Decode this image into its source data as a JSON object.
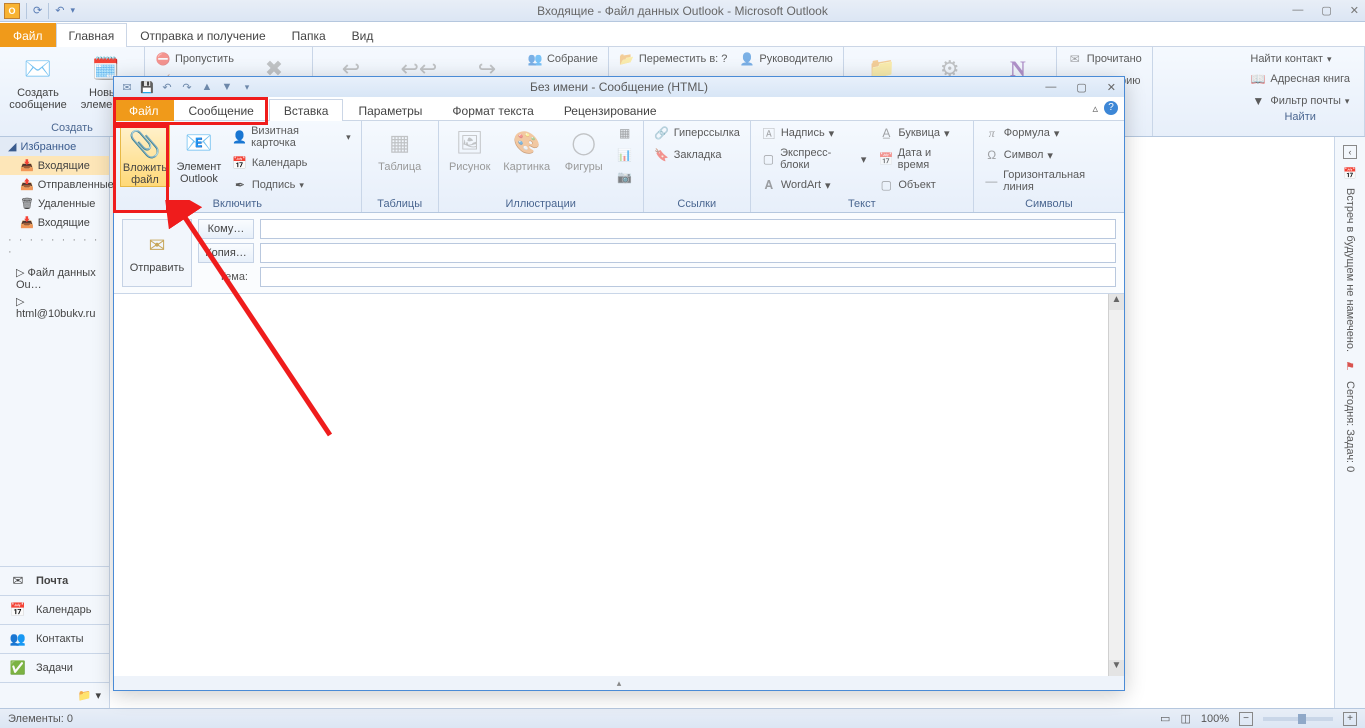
{
  "main_window": {
    "title": "Входящие - Файл данных Outlook  -  Microsoft Outlook",
    "tabs": {
      "file": "Файл",
      "home": "Главная",
      "sendrecv": "Отправка и получение",
      "folder": "Папка",
      "view": "Вид"
    },
    "ribbon": {
      "create": {
        "new_msg": "Создать\nсообщение",
        "new_items": "Новые\nэлементы",
        "title": "Создать"
      },
      "skip": "Пропустить",
      "meeting": "Собрание",
      "move_to": "Переместить в: ?",
      "manager": "Руководителю",
      "read": "Прочитано",
      "category": "Категорию",
      "search": {
        "find_contact": "Найти контакт",
        "addrbook": "Адресная книга",
        "mailfilter": "Фильтр почты",
        "title": "Найти"
      }
    },
    "nav": {
      "fav": "Избранное",
      "inbox": "Входящие",
      "sent": "Отправленные",
      "deleted": "Удаленные",
      "inbox2": "Входящие",
      "tree1": "Файл данных Ou…",
      "tree2": "html@10bukv.ru",
      "mail": "Почта",
      "cal": "Календарь",
      "contacts": "Контакты",
      "tasks": "Задачи"
    },
    "rightbar": {
      "line1": "Встреч в будущем не намечено.",
      "line2": "Сегодня: Задач: 0"
    },
    "status": {
      "items": "Элементы: 0",
      "zoom": "100%"
    }
  },
  "compose": {
    "title": "Без имени  -  Сообщение (HTML)",
    "tabs": {
      "file": "Файл",
      "msg": "Сообщение",
      "insert": "Вставка",
      "params": "Параметры",
      "format": "Формат текста",
      "review": "Рецензирование"
    },
    "ribbon": {
      "include": {
        "attach": "Вложить\nфайл",
        "item": "Элемент\nOutlook",
        "bizcard": "Визитная карточка",
        "calendar": "Календарь",
        "signature": "Подпись",
        "title": "Включить"
      },
      "tables": {
        "table": "Таблица",
        "title": "Таблицы"
      },
      "illus": {
        "picture": "Рисунок",
        "clipart": "Картинка",
        "shapes": "Фигуры",
        "title": "Иллюстрации"
      },
      "links": {
        "hyperlink": "Гиперссылка",
        "bookmark": "Закладка",
        "title": "Ссылки"
      },
      "text": {
        "textbox": "Надпись",
        "quick": "Экспресс-блоки",
        "wordart": "WordArt",
        "dropcap": "Буквица",
        "datetime": "Дата и время",
        "object": "Объект",
        "title": "Текст"
      },
      "symbols": {
        "formula": "Формула",
        "symbol": "Символ",
        "hline": "Горизонтальная линия",
        "title": "Символы"
      }
    },
    "fields": {
      "send": "Отправить",
      "to": "Кому…",
      "cc": "Копия…",
      "subject": "Тема:"
    }
  }
}
